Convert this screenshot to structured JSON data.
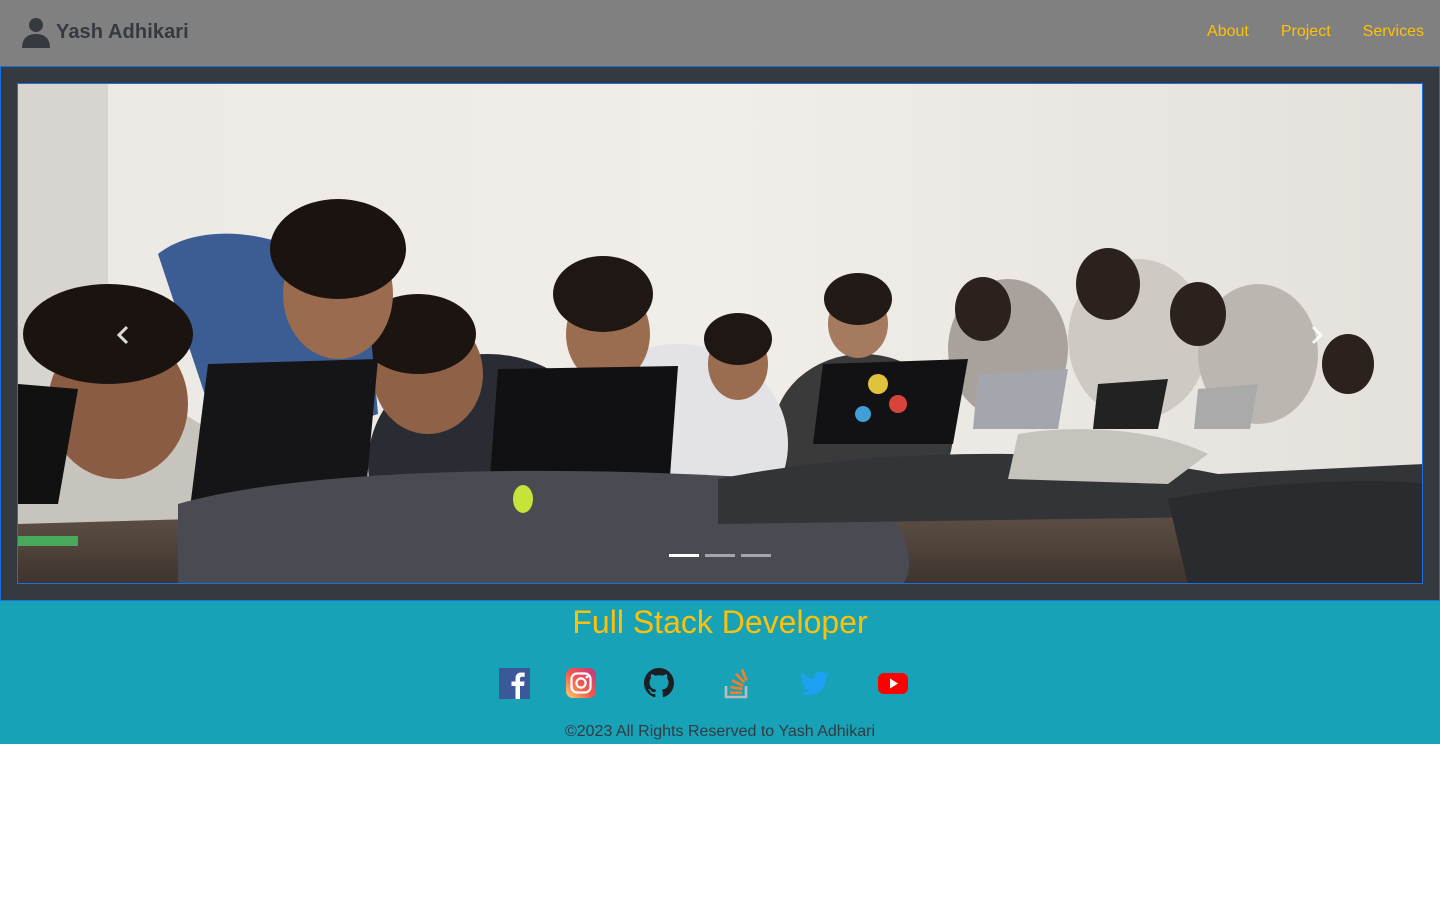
{
  "header": {
    "brand_name": "Yash Adhikari",
    "brand_icon": "user-icon",
    "nav": [
      "About",
      "Project",
      "Services"
    ]
  },
  "carousel": {
    "slide_count": 3,
    "active_slide": 1,
    "prev_icon": "chevron-left-icon",
    "next_icon": "chevron-right-icon"
  },
  "footer": {
    "role": "Full Stack Developer",
    "socials": [
      "facebook-icon",
      "instagram-icon",
      "github-icon",
      "stackoverflow-icon",
      "twitter-icon",
      "youtube-icon"
    ],
    "copyright": "©2023 All Rights Reserved to Yash Adhikari"
  },
  "colors": {
    "navbar_bg": "#808080",
    "accent": "#ffc107",
    "dark": "#343a40",
    "footer_bg": "#17a2b8",
    "border_blue": "#1d6fe0"
  }
}
